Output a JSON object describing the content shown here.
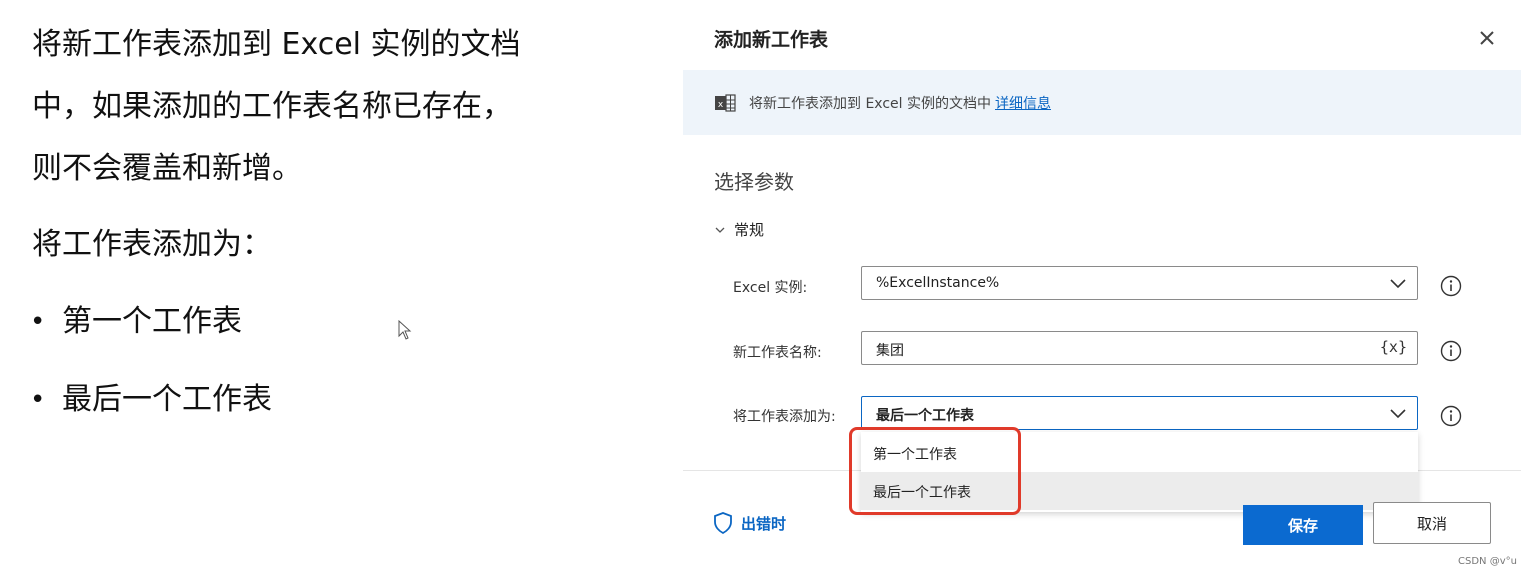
{
  "left_text": {
    "para1_line1": "将新工作表添加到 Excel 实例的文档",
    "para1_line2": "中，如果添加的工作表名称已存在，",
    "para1_line3": "则不会覆盖和新增。",
    "para2": "将工作表添加为：",
    "bullets": [
      "第一个工作表",
      "最后一个工作表"
    ]
  },
  "dialog": {
    "title": "添加新工作表",
    "banner": {
      "text": "将新工作表添加到 Excel 实例的文档中",
      "link": "详细信息"
    },
    "section_title": "选择参数",
    "group_header": "常规",
    "fields": [
      {
        "label": "Excel 实例:",
        "value": "%ExcelInstance%"
      },
      {
        "label": "新工作表名称:",
        "value": "集团",
        "badge": "{x}"
      },
      {
        "label": "将工作表添加为:",
        "value": "最后一个工作表"
      }
    ],
    "dropdown_options": [
      "第一个工作表",
      "最后一个工作表"
    ],
    "on_error": "出错时",
    "save_label": "保存",
    "cancel_label": "取消"
  },
  "watermark": "CSDN @v°u",
  "colors": {
    "accent": "#0b6ad0",
    "highlight": "#e03a2a",
    "banner_bg": "#eef4fa"
  }
}
